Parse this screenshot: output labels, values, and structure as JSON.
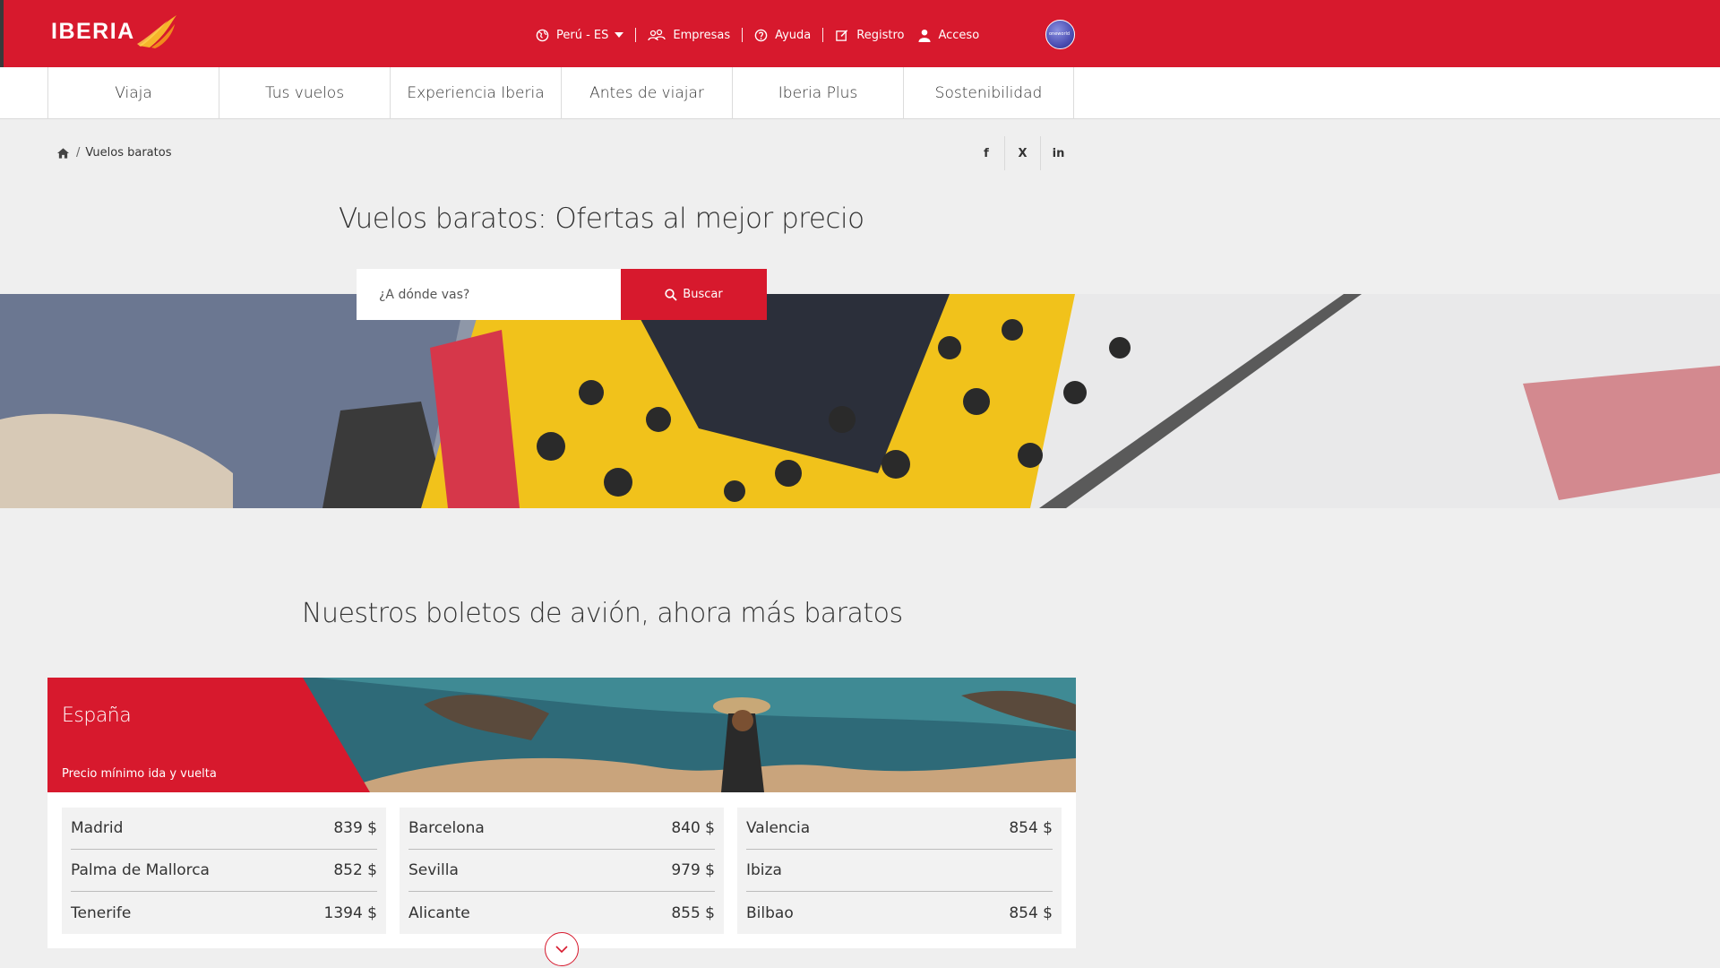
{
  "header": {
    "brand": "IBERIA",
    "region_label": "Perú - ES",
    "links": [
      {
        "label": "Empresas",
        "icon": "people-icon"
      },
      {
        "label": "Ayuda",
        "icon": "help-icon"
      },
      {
        "label": "Registro",
        "icon": "edit-icon"
      },
      {
        "label": "Acceso",
        "icon": "user-icon"
      }
    ],
    "alliance": "oneworld"
  },
  "nav": {
    "tabs": [
      "Viaja",
      "Tus vuelos",
      "Experiencia Iberia",
      "Antes de viajar",
      "Iberia Plus",
      "Sostenibilidad"
    ]
  },
  "breadcrumb": {
    "current": "Vuelos baratos"
  },
  "social": [
    "f",
    "X",
    "in"
  ],
  "hero": {
    "title": "Vuelos baratos: Ofertas al mejor precio",
    "search_placeholder": "¿A dónde vas?",
    "search_button": "Buscar"
  },
  "section": {
    "title": "Nuestros boletos de avión, ahora más baratos"
  },
  "card": {
    "country": "España",
    "subtitle": "Precio mínimo ida y vuelta",
    "columns": [
      [
        {
          "city": "Madrid",
          "price": "839 $"
        },
        {
          "city": "Palma de Mallorca",
          "price": "852 $"
        },
        {
          "city": "Tenerife",
          "price": "1394 $"
        }
      ],
      [
        {
          "city": "Barcelona",
          "price": "840 $"
        },
        {
          "city": "Sevilla",
          "price": "979 $"
        },
        {
          "city": "Alicante",
          "price": "855 $"
        }
      ],
      [
        {
          "city": "Valencia",
          "price": "854 $"
        },
        {
          "city": "Ibiza",
          "price": ""
        },
        {
          "city": "Bilbao",
          "price": "854 $"
        }
      ]
    ]
  },
  "colors": {
    "brand_red": "#d7192d",
    "background": "#efefef"
  }
}
